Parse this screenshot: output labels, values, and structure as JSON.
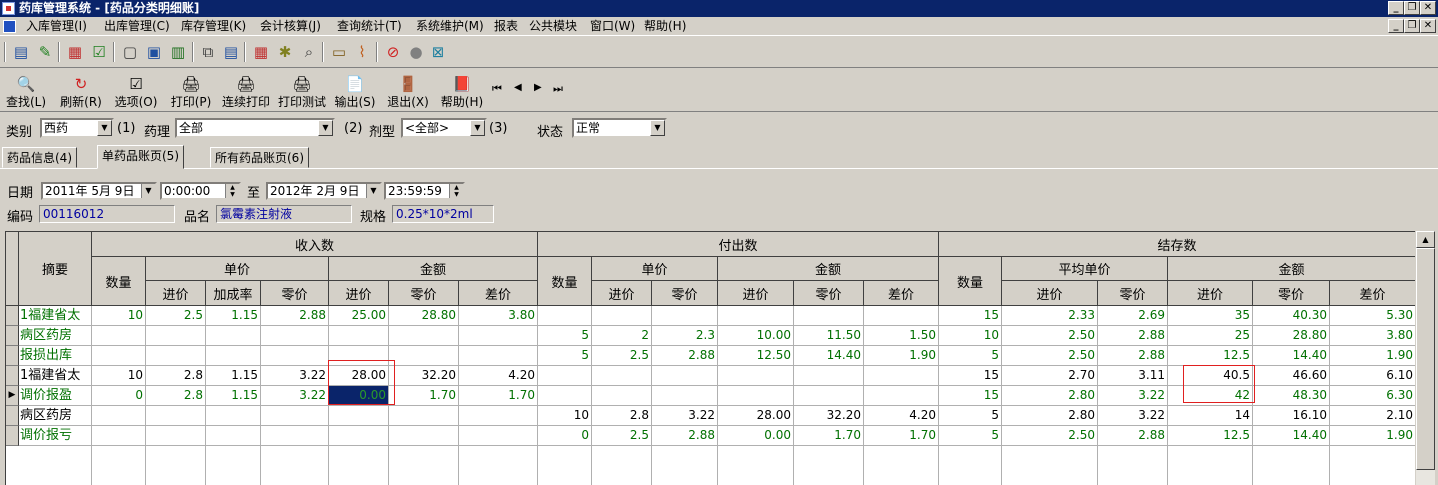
{
  "window": {
    "title": "药库管理系统 - [药品分类明细账]"
  },
  "menu": [
    "入库管理(I)",
    "出库管理(C)",
    "库存管理(K)",
    "会计核算(J)",
    "查询统计(T)",
    "系统维护(M)",
    "报表",
    "公共模块",
    "窗口(W)",
    "帮助(H)"
  ],
  "toolbar2": [
    {
      "label": "查找(L)",
      "icon": "🔍"
    },
    {
      "label": "刷新(R)",
      "icon": "↻"
    },
    {
      "label": "选项(O)",
      "icon": "☑"
    },
    {
      "label": "打印(P)",
      "icon": "🖨"
    },
    {
      "label": "连续打印",
      "icon": "🖨"
    },
    {
      "label": "打印测试",
      "icon": "🖨"
    },
    {
      "label": "输出(S)",
      "icon": "📄"
    },
    {
      "label": "退出(X)",
      "icon": "🚪"
    },
    {
      "label": "帮助(H)",
      "icon": "📕"
    }
  ],
  "nav": [
    "⏮",
    "◀",
    "▶",
    "⏭"
  ],
  "filters": {
    "category_label": "类别",
    "category_value": "西药",
    "tag1": "(1)",
    "pharm_label": "药理",
    "pharm_value": "全部",
    "tag2": "(2)",
    "form_label": "剂型",
    "form_value": "<全部>",
    "tag3": "(3)",
    "status_label": "状态",
    "status_value": "正常"
  },
  "tabs": [
    "药品信息(4)",
    "单药品账页(5)",
    "所有药品账页(6)"
  ],
  "dates": {
    "label": "日期",
    "from_date": "2011年 5月 9日",
    "from_time": "0:00:00",
    "to_label": "至",
    "to_date": "2012年 2月 9日",
    "to_time": "23:59:59"
  },
  "info": {
    "code_label": "编码",
    "code": "00116012",
    "name_label": "品名",
    "name": "氯霉素注射液",
    "spec_label": "规格",
    "spec": "0.25*10*2ml"
  },
  "headers": {
    "summary": "摘要",
    "income": "收入数",
    "outflow": "付出数",
    "balance": "结存数",
    "qty": "数量",
    "unit_price": "单价",
    "amount": "金额",
    "avg_price": "平均单价",
    "cost": "进价",
    "markup": "加成率",
    "retail": "零价",
    "diff": "差价"
  },
  "rows": [
    {
      "summary": "1福建省太",
      "color": "#007000",
      "in_qty": "10",
      "in_cost": "2.5",
      "in_markup": "1.15",
      "in_retail": "2.88",
      "in_amt_cost": "25.00",
      "in_amt_retail": "28.80",
      "in_amt_diff": "3.80",
      "out_qty": "",
      "out_cost": "",
      "out_retail": "",
      "out_amt_cost": "",
      "out_amt_retail": "",
      "out_amt_diff": "",
      "bal_qty": "15",
      "bal_cost": "2.33",
      "bal_retail": "2.69",
      "bal_amt_cost": "35",
      "bal_amt_retail": "40.30",
      "bal_amt_diff": "5.30"
    },
    {
      "summary": "病区药房",
      "color": "#007000",
      "in_qty": "",
      "in_cost": "",
      "in_markup": "",
      "in_retail": "",
      "in_amt_cost": "",
      "in_amt_retail": "",
      "in_amt_diff": "",
      "out_qty": "5",
      "out_cost": "2",
      "out_retail": "2.3",
      "out_amt_cost": "10.00",
      "out_amt_retail": "11.50",
      "out_amt_diff": "1.50",
      "bal_qty": "10",
      "bal_cost": "2.50",
      "bal_retail": "2.88",
      "bal_amt_cost": "25",
      "bal_amt_retail": "28.80",
      "bal_amt_diff": "3.80"
    },
    {
      "summary": "报损出库",
      "color": "#007000",
      "in_qty": "",
      "in_cost": "",
      "in_markup": "",
      "in_retail": "",
      "in_amt_cost": "",
      "in_amt_retail": "",
      "in_amt_diff": "",
      "out_qty": "5",
      "out_cost": "2.5",
      "out_retail": "2.88",
      "out_amt_cost": "12.50",
      "out_amt_retail": "14.40",
      "out_amt_diff": "1.90",
      "bal_qty": "5",
      "bal_cost": "2.50",
      "bal_retail": "2.88",
      "bal_amt_cost": "12.5",
      "bal_amt_retail": "14.40",
      "bal_amt_diff": "1.90"
    },
    {
      "summary": "1福建省太",
      "color": "#000000",
      "in_qty": "10",
      "in_cost": "2.8",
      "in_markup": "1.15",
      "in_retail": "3.22",
      "in_amt_cost": "28.00",
      "in_amt_retail": "32.20",
      "in_amt_diff": "4.20",
      "out_qty": "",
      "out_cost": "",
      "out_retail": "",
      "out_amt_cost": "",
      "out_amt_retail": "",
      "out_amt_diff": "",
      "bal_qty": "15",
      "bal_cost": "2.70",
      "bal_retail": "3.11",
      "bal_amt_cost": "40.5",
      "bal_amt_retail": "46.60",
      "bal_amt_diff": "6.10"
    },
    {
      "summary": "调价报盈",
      "color": "#007000",
      "in_qty": "0",
      "in_cost": "2.8",
      "in_markup": "1.15",
      "in_retail": "3.22",
      "in_amt_cost": "0.00",
      "in_amt_retail": "1.70",
      "in_amt_diff": "1.70",
      "out_qty": "",
      "out_cost": "",
      "out_retail": "",
      "out_amt_cost": "",
      "out_amt_retail": "",
      "out_amt_diff": "",
      "bal_qty": "15",
      "bal_cost": "2.80",
      "bal_retail": "3.22",
      "bal_amt_cost": "42",
      "bal_amt_retail": "48.30",
      "bal_amt_diff": "6.30"
    },
    {
      "summary": "病区药房",
      "color": "#000000",
      "in_qty": "",
      "in_cost": "",
      "in_markup": "",
      "in_retail": "",
      "in_amt_cost": "",
      "in_amt_retail": "",
      "in_amt_diff": "",
      "out_qty": "10",
      "out_cost": "2.8",
      "out_retail": "3.22",
      "out_amt_cost": "28.00",
      "out_amt_retail": "32.20",
      "out_amt_diff": "4.20",
      "bal_qty": "5",
      "bal_cost": "2.80",
      "bal_retail": "3.22",
      "bal_amt_cost": "14",
      "bal_amt_retail": "16.10",
      "bal_amt_diff": "2.10"
    },
    {
      "summary": "调价报亏",
      "color": "#007000",
      "in_qty": "",
      "in_cost": "",
      "in_markup": "",
      "in_retail": "",
      "in_amt_cost": "",
      "in_amt_retail": "",
      "in_amt_diff": "",
      "out_qty": "0",
      "out_cost": "2.5",
      "out_retail": "2.88",
      "out_amt_cost": "0.00",
      "out_amt_retail": "1.70",
      "out_amt_diff": "1.70",
      "bal_qty": "5",
      "bal_cost": "2.50",
      "bal_retail": "2.88",
      "bal_amt_cost": "12.5",
      "bal_amt_retail": "14.40",
      "bal_amt_diff": "1.90"
    }
  ],
  "current_row": 4,
  "selected_cell": {
    "row": 4,
    "col": "in_amt_cost"
  },
  "colors": {
    "title_bar": "#0a246a",
    "selection": "#0a246a",
    "green_text": "#007000",
    "highlight_box": "#e02020"
  }
}
